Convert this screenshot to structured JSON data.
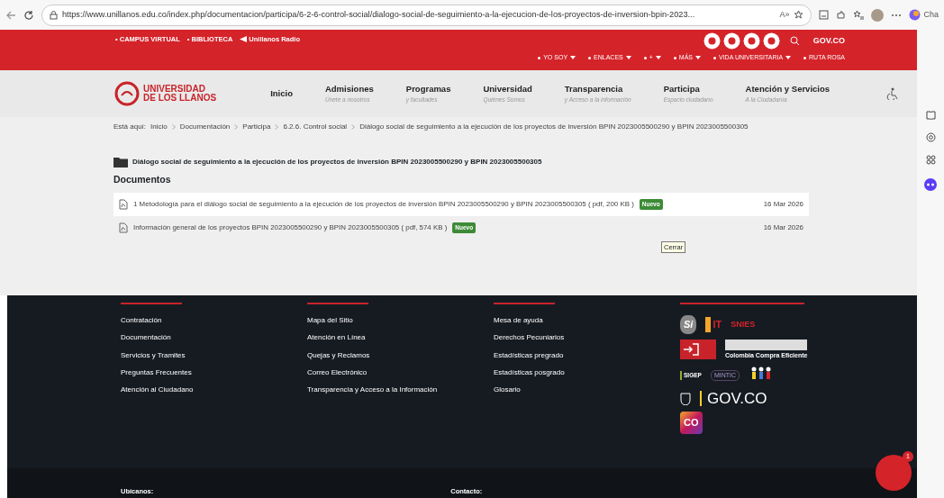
{
  "browser": {
    "url": "https://www.unillanos.edu.co/index.php/documentacion/participa/6-2-6-control-social/dialogo-social-de-seguimiento-a-la-ejecucion-de-los-proyectos-de-inversion-bpin-2023...",
    "read_aloud": "A»",
    "profile_tab": "Cha"
  },
  "topbar": {
    "links": [
      "• CAMPUS VIRTUAL",
      "• BIBLIOTECA"
    ],
    "radio": "Unillanos Radio",
    "gov": "GOV.CO",
    "menu": [
      {
        "label": "YO SOY",
        "dropdown": true
      },
      {
        "label": "ENLACES",
        "dropdown": true
      },
      {
        "label": "+",
        "dropdown": true
      },
      {
        "label": "MÁS",
        "dropdown": true
      },
      {
        "label": "VIDA UNIVERSITARIA",
        "dropdown": true
      },
      {
        "label": "RUTA ROSA",
        "dropdown": false
      }
    ]
  },
  "logo": {
    "line1": "UNIVERSIDAD",
    "line2": "DE LOS LLANOS"
  },
  "nav": [
    {
      "title": "Inicio"
    },
    {
      "title": "Admisiones",
      "subtitle": "Únete a nosotros"
    },
    {
      "title": "Programas",
      "subtitle": "y facultades"
    },
    {
      "title": "Universidad",
      "subtitle": "Quiénes Somos"
    },
    {
      "title": "Transparencia",
      "subtitle": "y Acceso a la información"
    },
    {
      "title": "Participa",
      "subtitle": "Espacio ciudadano"
    },
    {
      "title": "Atención y Servicios",
      "subtitle": "A la Ciudadanía"
    }
  ],
  "breadcrumb": {
    "label": "Está aquí:",
    "items": [
      "Inicio",
      "Documentación",
      "Participa",
      "6.2.6. Control social",
      "Diálogo social de seguimiento a la ejecución de los proyectos de inversión BPIN 2023005500290 y BPIN 2023005500305"
    ]
  },
  "folder_title": "Diálogo social de seguimiento a la ejecución de los proyectos de inversión BPIN 2023005500290 y BPIN 2023005500305",
  "section_title": "Documentos",
  "documents": [
    {
      "title": "1 Metodología para el diálogo social de seguimiento a la ejecución de los proyectos de inversión BPIN 2023005500290 y BPIN 2023005500305 ( pdf, 200 KB )",
      "badge": "Nuevo",
      "date": "16 Mar 2026",
      "highlighted": true
    },
    {
      "title": "Información general de los proyectos BPIN 2023005500290 y BPIN 2023005500305 ( pdf, 574 KB )",
      "badge": "Nuevo",
      "date": "16 Mar 2026",
      "highlighted": false
    }
  ],
  "tooltip": "Cerrar",
  "footer": {
    "columns": [
      [
        "Contratación",
        "Documentación",
        "Servicios y Tramites",
        "Preguntas Frecuentes",
        "Atención al Ciudadano"
      ],
      [
        "Mapa del Sitio",
        "Atención en Línea",
        "Quejas y Reclamos",
        "Correo Electrónico",
        "Transparencia y Acceso a la Información"
      ],
      [
        "Mesa de ayuda",
        "Derechos Pecuniarios",
        "Estadísticas pregrado",
        "Estadísticas posgrado",
        "Glosario"
      ]
    ],
    "logos": {
      "si": "Si",
      "suit": "IT",
      "snies": "SNIES",
      "compra": "Colombia Compra Eficiente",
      "sigep": "SIGEP",
      "mintic": "MINTIC",
      "gov": "GOV.CO",
      "co": "CO"
    },
    "bottom": [
      "Ubícanos:",
      "Contacto:"
    ]
  },
  "chat": {
    "count": "1"
  }
}
